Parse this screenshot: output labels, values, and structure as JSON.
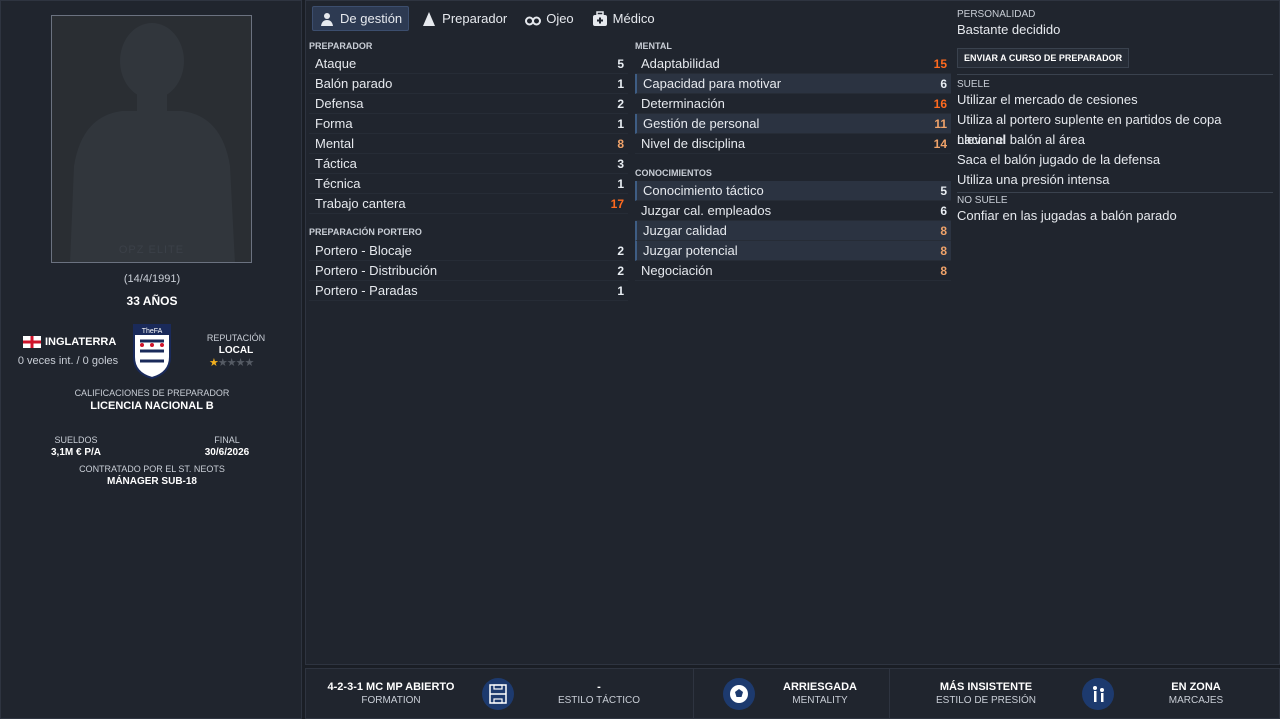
{
  "profile": {
    "photo_watermark": "OPZ ELITE",
    "dob": "(14/4/1991)",
    "age": "33 AÑOS",
    "nation": "INGLATERRA",
    "caps": "0 veces int. / 0 goles",
    "crest_text": "TheFA",
    "rep_label": "REPUTACIÓN",
    "rep_value": "LOCAL",
    "qual_label": "CALIFICACIONES DE PREPARADOR",
    "qual_value": "LICENCIA NACIONAL B",
    "wage_label": "SUELDOS",
    "wage_value": "3,1M € P/A",
    "end_label": "FINAL",
    "end_value": "30/6/2026",
    "contract_label": "CONTRATADO POR EL ST. NEOTS",
    "contract_value": "MÁNAGER SUB-18"
  },
  "tabs": [
    "De gestión",
    "Preparador",
    "Ojeo",
    "Médico"
  ],
  "sections": {
    "coach": "PREPARADOR",
    "gk": "PREPARACIÓN PORTERO",
    "mental": "MENTAL",
    "knowledge": "CONOCIMIENTOS"
  },
  "coach": [
    {
      "n": "Ataque",
      "v": "5"
    },
    {
      "n": "Balón parado",
      "v": "1"
    },
    {
      "n": "Defensa",
      "v": "2"
    },
    {
      "n": "Forma",
      "v": "1"
    },
    {
      "n": "Mental",
      "v": "8"
    },
    {
      "n": "Táctica",
      "v": "3"
    },
    {
      "n": "Técnica",
      "v": "1"
    },
    {
      "n": "Trabajo cantera",
      "v": "17"
    }
  ],
  "gk": [
    {
      "n": "Portero - Blocaje",
      "v": "2"
    },
    {
      "n": "Portero - Distribución",
      "v": "2"
    },
    {
      "n": "Portero - Paradas",
      "v": "1"
    }
  ],
  "mental": [
    {
      "n": "Adaptabilidad",
      "v": "15"
    },
    {
      "n": "Capacidad para motivar",
      "v": "6"
    },
    {
      "n": "Determinación",
      "v": "16"
    },
    {
      "n": "Gestión de personal",
      "v": "11"
    },
    {
      "n": "Nivel de disciplina",
      "v": "14"
    }
  ],
  "knowledge": [
    {
      "n": "Conocimiento táctico",
      "v": "5"
    },
    {
      "n": "Juzgar cal. empleados",
      "v": "6"
    },
    {
      "n": "Juzgar calidad",
      "v": "8"
    },
    {
      "n": "Juzgar potencial",
      "v": "8"
    },
    {
      "n": "Negociación",
      "v": "8"
    }
  ],
  "right": {
    "pers_label": "PERSONALIDAD",
    "pers_value": "Bastante decidido",
    "course_button": "ENVIAR A CURSO DE PREPARADOR",
    "tends_label": "SUELE",
    "tends": [
      "Utilizar el mercado de cesiones",
      "Utiliza al portero suplente en partidos de copa nacional",
      "Llevar el balón al área",
      "Saca el balón jugado de la defensa",
      "Utiliza una presión intensa"
    ],
    "not_label": "NO SUELE",
    "not": [
      "Confiar en las jugadas a balón parado"
    ]
  },
  "footer": {
    "formation": "4-2-3-1 MC MP ABIERTO",
    "formation_label": "FORMATION",
    "style": "-",
    "style_label": "ESTILO TÁCTICO",
    "mentality": "ARRIESGADA",
    "mentality_label": "MENTALITY",
    "press": "MÁS INSISTENTE",
    "press_label": "ESTILO DE PRESIÓN",
    "marking": "EN ZONA",
    "marking_label": "MARCAJES"
  }
}
